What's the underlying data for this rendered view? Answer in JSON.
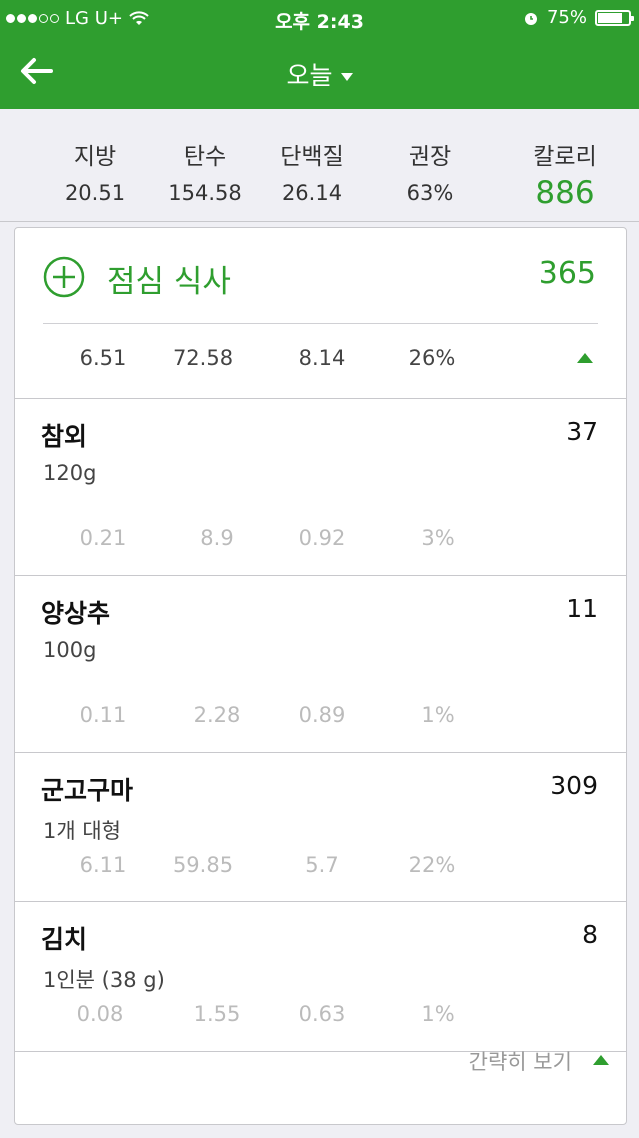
{
  "status": {
    "carrier": "LG U+",
    "time": "오후 2:43",
    "battery": "75%"
  },
  "nav": {
    "title": "오늘"
  },
  "summary": {
    "fat_label": "지방",
    "fat": "20.51",
    "carb_label": "탄수",
    "carb": "154.58",
    "protein_label": "단백질",
    "protein": "26.14",
    "rec_label": "권장",
    "rec": "63%",
    "cal_label": "칼로리",
    "cal": "886"
  },
  "meal": {
    "name": "점심 식사",
    "calories": "365",
    "fat": "6.51",
    "carb": "72.58",
    "protein": "8.14",
    "pct": "26%"
  },
  "foods": [
    {
      "name": "참외",
      "serving": "120g",
      "calories": "37",
      "fat": "0.21",
      "carb": "8.9",
      "protein": "0.92",
      "pct": "3%"
    },
    {
      "name": "양상추",
      "serving": "100g",
      "calories": "11",
      "fat": "0.11",
      "carb": "2.28",
      "protein": "0.89",
      "pct": "1%"
    },
    {
      "name": "군고구마",
      "serving": "1개 대형",
      "calories": "309",
      "fat": "6.11",
      "carb": "59.85",
      "protein": "5.7",
      "pct": "22%"
    },
    {
      "name": "김치",
      "serving": "1인분 (38 g)",
      "calories": "8",
      "fat": "0.08",
      "carb": "1.55",
      "protein": "0.63",
      "pct": "1%"
    }
  ],
  "footer": {
    "toggle_label": "간략히 보기"
  },
  "colors": {
    "accent": "#2f9e2f",
    "background": "#efeff4"
  }
}
